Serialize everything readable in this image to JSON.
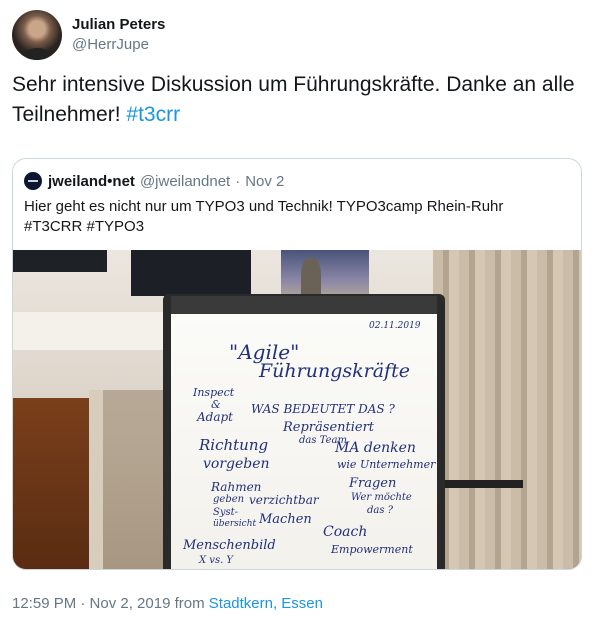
{
  "author": {
    "display_name": "Julian Peters",
    "handle": "@HerrJupe"
  },
  "tweet": {
    "text": "Sehr intensive Diskussion um Führungskräfte. Danke an alle Teilnehmer! ",
    "hashtag": "#t3crr"
  },
  "quoted": {
    "display_name": "jweiland•net",
    "handle": "@jweilandnet",
    "separator": "·",
    "date": "Nov 2",
    "text_line1": "Hier geht es nicht nur um TYPO3 und Technik! TYPO3camp Rhein-Ruhr",
    "text_line2": "#T3CRR #TYPO3",
    "flipchart": {
      "date": "02.11.2019",
      "title1": "\"Agile\"",
      "title2": "Führungskräfte",
      "l1": "Inspect",
      "l2": "&",
      "l3": "Adapt",
      "question": "WAS BEDEUTET DAS ?",
      "rep1": "Repräsentiert",
      "rep2": "das Team",
      "ma1": "MA denken",
      "ma2": "wie Unternehmer",
      "rich1": "Richtung",
      "rich2": "vorgeben",
      "rahmen1": "Rahmen",
      "rahmen2": "geben",
      "verz": "verzichtbar",
      "sys1": "Syst-",
      "sys2": "übersicht",
      "machen": "Machen",
      "fragen": "Fragen",
      "wer": "Wer möchte",
      "das": "das ?",
      "coach": "Coach",
      "empower": "Empowerment",
      "mensch": "Menschenbild",
      "xy": "X vs. Y"
    }
  },
  "footer": {
    "time_date": "12:59 PM · Nov 2, 2019 from ",
    "location": "Stadtkern, Essen"
  },
  "colors": {
    "link": "#1b95e0",
    "secondary": "#657786",
    "border": "#ccd6dd"
  }
}
